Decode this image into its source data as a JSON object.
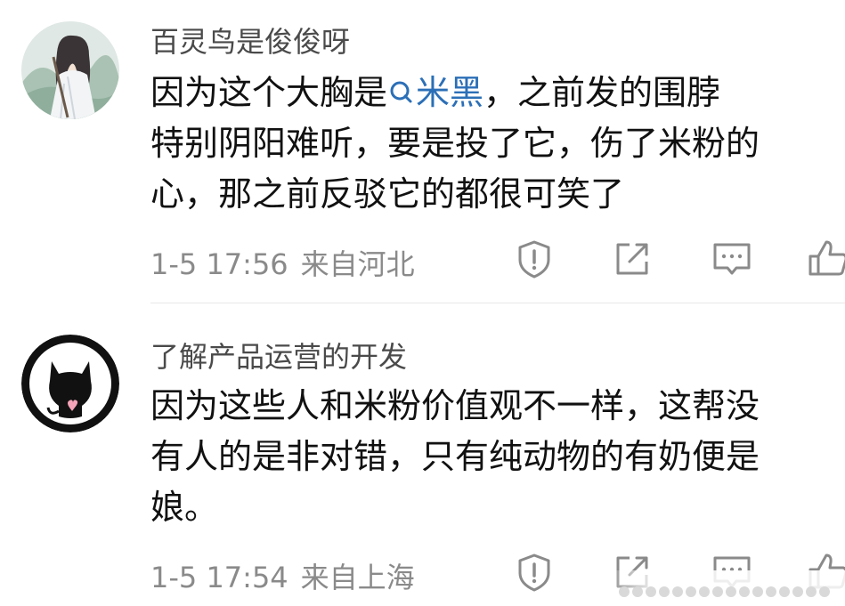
{
  "comments": [
    {
      "username": "百灵鸟是俊俊呀",
      "avatar": "anime-character-avatar",
      "body_line1_before": "因为这个大胸是",
      "body_link": "米黑",
      "body_line1_after": "，之前发的围脖",
      "body_line2": "特别阴阳难听，要是投了它，伤了米粉的",
      "body_line3": "心，那之前反驳它的都很可笑了",
      "time": "1-5 17:56",
      "location": "来自河北"
    },
    {
      "username": "了解产品运营的开发",
      "avatar": "black-cat-avatar",
      "body_line1": "因为这些人和米粉价值观不一样，这帮没",
      "body_line2": "有人的是非对错，只有纯动物的有奶便是",
      "body_line3": "娘。",
      "time": "1-5 17:54",
      "location": "来自上海"
    }
  ],
  "icons": {
    "report": "report-icon",
    "share": "share-icon",
    "comment": "comment-icon",
    "like": "like-icon",
    "link": "search-link-icon"
  },
  "colors": {
    "link": "#2b6fb7",
    "meta": "#8a8a8a",
    "username": "#4a4a4a"
  }
}
